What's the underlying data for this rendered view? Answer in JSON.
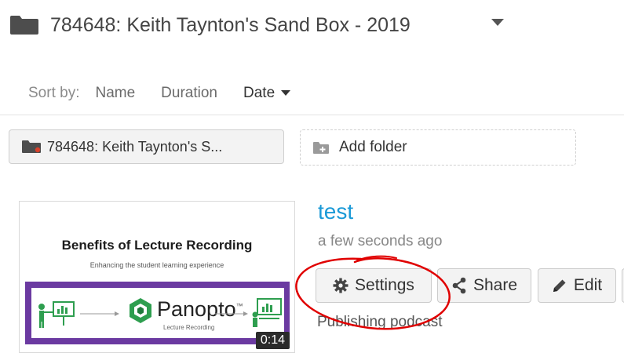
{
  "header": {
    "folder_title": "784648: Keith Taynton's Sand Box - 2019",
    "folder_icon": "folder-icon",
    "dropdown_icon": "caret-down-icon"
  },
  "sort": {
    "label": "Sort by:",
    "options": [
      "Name",
      "Duration",
      "Date"
    ],
    "active": "Date",
    "active_indicator_icon": "caret-down-icon"
  },
  "folders": {
    "current_label": "784648: Keith Taynton's S...",
    "current_icon": "folder-shared-icon",
    "add_label": "Add folder",
    "add_icon": "add-folder-icon"
  },
  "session": {
    "title": "test",
    "time": "a few seconds ago",
    "status": "Publishing podcast",
    "thumbnail": {
      "title": "Benefits of Lecture Recording",
      "subtitle": "Enhancing the student learning experience",
      "brand": "Panopto",
      "brand_sub": "Lecture Recording",
      "trademark": "™",
      "duration": "0:14"
    },
    "actions": {
      "settings": "Settings",
      "share": "Share",
      "edit": "Edit"
    }
  },
  "colors": {
    "link": "#1b9ad7",
    "thumbnail_band": "#6b3aa1",
    "annotation": "#e00000",
    "logo_green": "#2e9e4f"
  }
}
